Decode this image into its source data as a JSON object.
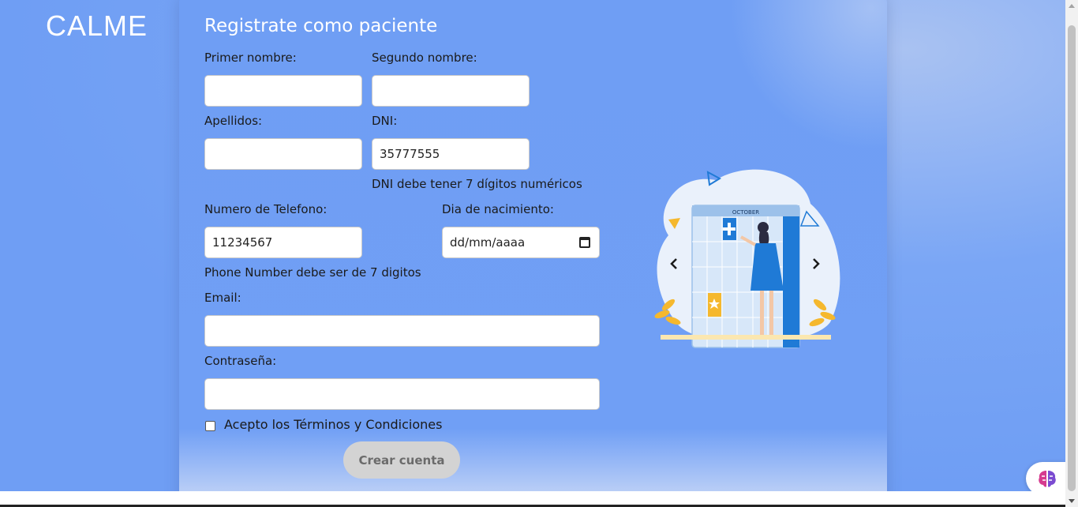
{
  "brand": {
    "logo_text": "CALME"
  },
  "form": {
    "title": "Registrate como paciente",
    "first_name": {
      "label": "Primer nombre:",
      "value": ""
    },
    "middle_name": {
      "label": "Segundo nombre:",
      "value": ""
    },
    "last_name": {
      "label": "Apellidos:",
      "value": ""
    },
    "dni": {
      "label": "DNI:",
      "value": "35777555",
      "error": "DNI debe tener 7 dígitos numéricos"
    },
    "phone": {
      "label": "Numero de Telefono:",
      "value": "11234567",
      "error": "Phone Number debe ser de 7 digitos"
    },
    "birthdate": {
      "label": "Dia de nacimiento:",
      "placeholder": "dd/mm/aaaa",
      "icon": "calendar-icon"
    },
    "email": {
      "label": "Email:",
      "value": ""
    },
    "password": {
      "label": "Contraseña:",
      "value": ""
    },
    "terms": {
      "label": "Acepto los Términos y Condiciones",
      "checked": false
    },
    "submit_label": "Crear cuenta"
  },
  "illustration": {
    "calendar_month": "OCTOBER",
    "alt_icon": "calendar-woman-illustration"
  },
  "floating_button": {
    "icon": "brain-icon"
  },
  "colors": {
    "background": "#6f9ef4",
    "button": "#d3d3d3",
    "accent_blue": "#1f7ad6",
    "accent_yellow": "#f5b82e"
  }
}
